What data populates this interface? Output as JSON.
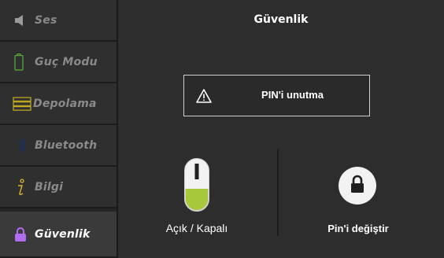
{
  "sidebar": {
    "items": [
      {
        "label": "Ses",
        "icon": "speaker-icon"
      },
      {
        "label": "Guç Modu",
        "icon": "battery-icon"
      },
      {
        "label": "Depolama",
        "icon": "storage-icon"
      },
      {
        "label": "Bluetooth",
        "icon": "bluetooth-icon"
      },
      {
        "label": "Bilgi",
        "icon": "info-icon"
      },
      {
        "label": "Güvenlik",
        "icon": "lock-icon",
        "active": true
      }
    ]
  },
  "main": {
    "title": "Güvenlik",
    "warning": {
      "text": "PIN'i unutma",
      "icon": "warning-icon"
    },
    "toggle": {
      "label": "Açık / Kapalı",
      "state": "on"
    },
    "change_pin": {
      "label": "Pin'i değiştir",
      "icon": "lock-icon"
    }
  },
  "colors": {
    "accent_green": "#a8c83c",
    "lock_purple": "#b06cf0",
    "battery_green": "#5fae3a",
    "storage_yellow": "#c8b021",
    "info_yellow": "#d8b62a"
  }
}
